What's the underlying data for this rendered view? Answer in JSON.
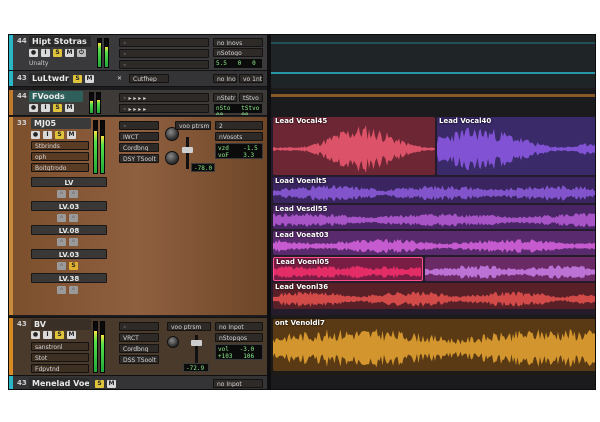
{
  "tracks": {
    "t1": {
      "number": "44",
      "name": "Hipt Stotras",
      "sends": [
        "no Inovs",
        "nSotogo"
      ],
      "lcd": "5.5   0   0",
      "mode": "Unalty"
    },
    "t2": {
      "number": "43",
      "name": "LuLtwdr",
      "slot": "Cutfhep",
      "sends": [
        "no Inoot",
        "vo 1ntme"
      ]
    },
    "t3": {
      "number": "44",
      "name": "FVoods",
      "lcd": "nSto   tStvo\n00     00",
      "sends": [
        "nStetr",
        "tStvo"
      ]
    },
    "main": {
      "number": "33",
      "name": "MJ05",
      "chips": [
        "Stbrinds",
        "oph",
        "Boitgtrodo"
      ],
      "inserts": [
        "IWCT",
        "Cordbng",
        "DSY TSoolt"
      ],
      "send_label": "voo ptrsm",
      "send_val": "2",
      "send2": "nVosots",
      "lcd": "vzd    -1.5\nvoF    3.3",
      "knob_val": "-78.0"
    },
    "lvs": [
      "LV",
      "LV.03",
      "LV.08",
      "LV.03",
      "LV.38"
    ],
    "bv": {
      "number": "43",
      "name": "BV",
      "chips": [
        "sanstronl",
        "Stot",
        "Fdpvtnd"
      ],
      "inserts": [
        "VRCT",
        "Cordbng",
        "DSS TSoolt"
      ],
      "send_label": "voo ptrsm",
      "send2": "no Inpot",
      "send3": "nStopgos",
      "lcd": "vol   -3.0\n+103   106",
      "fader_val": "-72.9"
    },
    "last": {
      "number": "43",
      "name": "Menelad Voe",
      "send": "no Inpot"
    }
  },
  "clips": {
    "lead_a": "Lead Vocal45",
    "lead_b": "Lead Vocal40",
    "comp1": "Load Voenlt5",
    "comp2": "Lead Vesdl55",
    "comp3": "Lead Voeat03",
    "comp4": "Lead Voenl05",
    "comp5": "Lead Veonl36",
    "bv_clip": "ont Venoldl7"
  },
  "colors": {
    "main_track": "#8b5a32",
    "bv_track": "#b56b22",
    "accent_cyan": "#2bb6c8",
    "lead_a": "#e8586e",
    "lead_b": "#8a58e0",
    "bv_clip": "#e0a030",
    "red_clip": "#f0306a"
  }
}
